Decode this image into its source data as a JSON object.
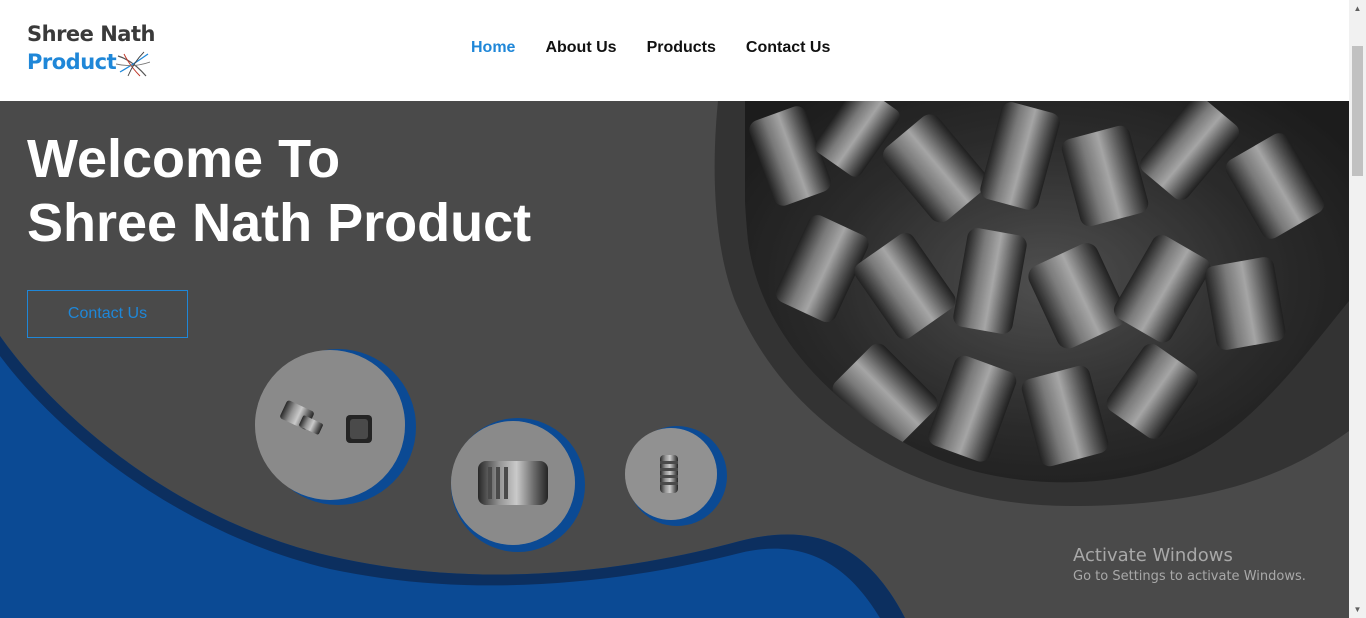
{
  "brand": {
    "line1": "Shree Nath",
    "line2": "Product"
  },
  "nav": {
    "items": [
      {
        "label": "Home",
        "active": true
      },
      {
        "label": "About Us",
        "active": false
      },
      {
        "label": "Products",
        "active": false
      },
      {
        "label": "Contact Us",
        "active": false
      }
    ]
  },
  "hero": {
    "title_line1": "Welcome To",
    "title_line2": "Shree Nath Product",
    "cta_label": "Contact Us"
  },
  "watermark": {
    "title": "Activate Windows",
    "subtitle": "Go to Settings to activate Windows."
  },
  "colors": {
    "accent": "#1f87d8",
    "hero_bg": "#4a4a4a",
    "wave_blue": "#0b4a94",
    "wave_dark": "#0c2f5f",
    "header_bg": "#ffffff"
  }
}
